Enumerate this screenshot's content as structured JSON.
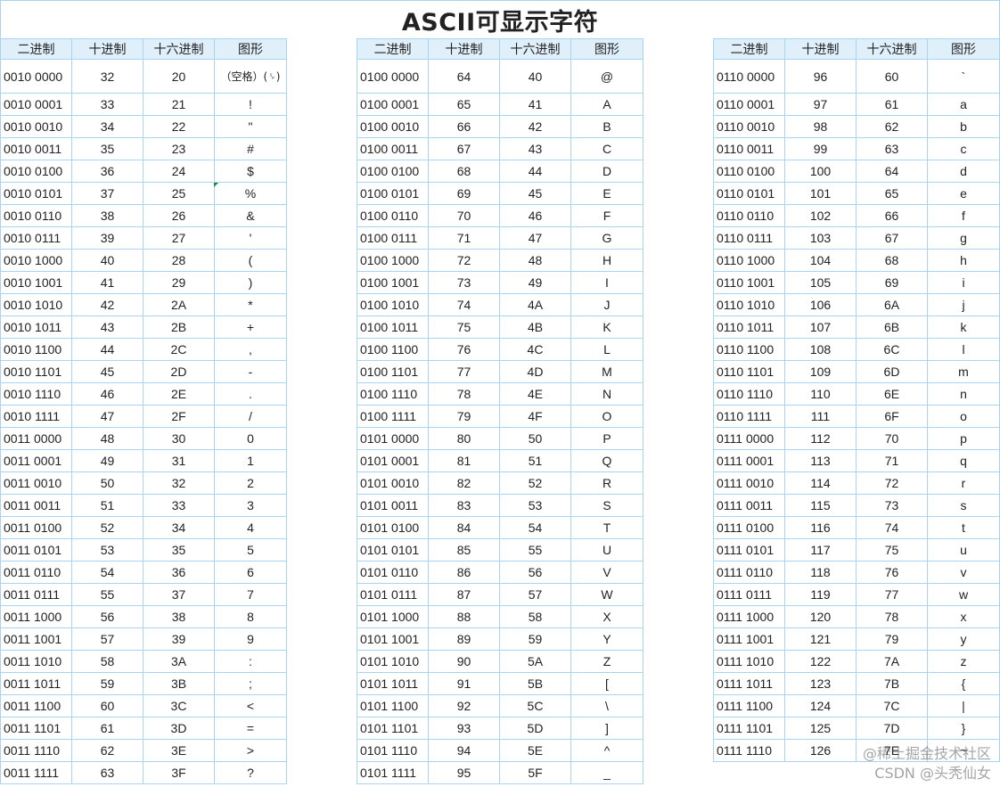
{
  "title": "ASCII可显示字符",
  "headers": [
    "二进制",
    "十进制",
    "十六进制",
    "图形"
  ],
  "tables": [
    [
      [
        "0010 0000",
        "32",
        "20",
        "（空格）(␠)"
      ],
      [
        "0010 0001",
        "33",
        "21",
        "!"
      ],
      [
        "0010 0010",
        "34",
        "22",
        "\""
      ],
      [
        "0010 0011",
        "35",
        "23",
        "#"
      ],
      [
        "0010 0100",
        "36",
        "24",
        "$"
      ],
      [
        "0010 0101",
        "37",
        "25",
        "%"
      ],
      [
        "0010 0110",
        "38",
        "26",
        "&"
      ],
      [
        "0010 0111",
        "39",
        "27",
        "'"
      ],
      [
        "0010 1000",
        "40",
        "28",
        "("
      ],
      [
        "0010 1001",
        "41",
        "29",
        ")"
      ],
      [
        "0010 1010",
        "42",
        "2A",
        "*"
      ],
      [
        "0010 1011",
        "43",
        "2B",
        "+"
      ],
      [
        "0010 1100",
        "44",
        "2C",
        ","
      ],
      [
        "0010 1101",
        "45",
        "2D",
        "-"
      ],
      [
        "0010 1110",
        "46",
        "2E",
        "."
      ],
      [
        "0010 1111",
        "47",
        "2F",
        "/"
      ],
      [
        "0011 0000",
        "48",
        "30",
        "0"
      ],
      [
        "0011 0001",
        "49",
        "31",
        "1"
      ],
      [
        "0011 0010",
        "50",
        "32",
        "2"
      ],
      [
        "0011 0011",
        "51",
        "33",
        "3"
      ],
      [
        "0011 0100",
        "52",
        "34",
        "4"
      ],
      [
        "0011 0101",
        "53",
        "35",
        "5"
      ],
      [
        "0011 0110",
        "54",
        "36",
        "6"
      ],
      [
        "0011 0111",
        "55",
        "37",
        "7"
      ],
      [
        "0011 1000",
        "56",
        "38",
        "8"
      ],
      [
        "0011 1001",
        "57",
        "39",
        "9"
      ],
      [
        "0011 1010",
        "58",
        "3A",
        ":"
      ],
      [
        "0011 1011",
        "59",
        "3B",
        ";"
      ],
      [
        "0011 1100",
        "60",
        "3C",
        "<"
      ],
      [
        "0011 1101",
        "61",
        "3D",
        "="
      ],
      [
        "0011 1110",
        "62",
        "3E",
        ">"
      ],
      [
        "0011 1111",
        "63",
        "3F",
        "?"
      ]
    ],
    [
      [
        "0100 0000",
        "64",
        "40",
        "@"
      ],
      [
        "0100 0001",
        "65",
        "41",
        "A"
      ],
      [
        "0100 0010",
        "66",
        "42",
        "B"
      ],
      [
        "0100 0011",
        "67",
        "43",
        "C"
      ],
      [
        "0100 0100",
        "68",
        "44",
        "D"
      ],
      [
        "0100 0101",
        "69",
        "45",
        "E"
      ],
      [
        "0100 0110",
        "70",
        "46",
        "F"
      ],
      [
        "0100 0111",
        "71",
        "47",
        "G"
      ],
      [
        "0100 1000",
        "72",
        "48",
        "H"
      ],
      [
        "0100 1001",
        "73",
        "49",
        "I"
      ],
      [
        "0100 1010",
        "74",
        "4A",
        "J"
      ],
      [
        "0100 1011",
        "75",
        "4B",
        "K"
      ],
      [
        "0100 1100",
        "76",
        "4C",
        "L"
      ],
      [
        "0100 1101",
        "77",
        "4D",
        "M"
      ],
      [
        "0100 1110",
        "78",
        "4E",
        "N"
      ],
      [
        "0100 1111",
        "79",
        "4F",
        "O"
      ],
      [
        "0101 0000",
        "80",
        "50",
        "P"
      ],
      [
        "0101 0001",
        "81",
        "51",
        "Q"
      ],
      [
        "0101 0010",
        "82",
        "52",
        "R"
      ],
      [
        "0101 0011",
        "83",
        "53",
        "S"
      ],
      [
        "0101 0100",
        "84",
        "54",
        "T"
      ],
      [
        "0101 0101",
        "85",
        "55",
        "U"
      ],
      [
        "0101 0110",
        "86",
        "56",
        "V"
      ],
      [
        "0101 0111",
        "87",
        "57",
        "W"
      ],
      [
        "0101 1000",
        "88",
        "58",
        "X"
      ],
      [
        "0101 1001",
        "89",
        "59",
        "Y"
      ],
      [
        "0101 1010",
        "90",
        "5A",
        "Z"
      ],
      [
        "0101 1011",
        "91",
        "5B",
        "["
      ],
      [
        "0101 1100",
        "92",
        "5C",
        "\\"
      ],
      [
        "0101 1101",
        "93",
        "5D",
        "]"
      ],
      [
        "0101 1110",
        "94",
        "5E",
        "^"
      ],
      [
        "0101 1111",
        "95",
        "5F",
        "_"
      ]
    ],
    [
      [
        "0110 0000",
        "96",
        "60",
        "`"
      ],
      [
        "0110 0001",
        "97",
        "61",
        "a"
      ],
      [
        "0110 0010",
        "98",
        "62",
        "b"
      ],
      [
        "0110 0011",
        "99",
        "63",
        "c"
      ],
      [
        "0110 0100",
        "100",
        "64",
        "d"
      ],
      [
        "0110 0101",
        "101",
        "65",
        "e"
      ],
      [
        "0110 0110",
        "102",
        "66",
        "f"
      ],
      [
        "0110 0111",
        "103",
        "67",
        "g"
      ],
      [
        "0110 1000",
        "104",
        "68",
        "h"
      ],
      [
        "0110 1001",
        "105",
        "69",
        "i"
      ],
      [
        "0110 1010",
        "106",
        "6A",
        "j"
      ],
      [
        "0110 1011",
        "107",
        "6B",
        "k"
      ],
      [
        "0110 1100",
        "108",
        "6C",
        "l"
      ],
      [
        "0110 1101",
        "109",
        "6D",
        "m"
      ],
      [
        "0110 1110",
        "110",
        "6E",
        "n"
      ],
      [
        "0110 1111",
        "111",
        "6F",
        "o"
      ],
      [
        "0111 0000",
        "112",
        "70",
        "p"
      ],
      [
        "0111 0001",
        "113",
        "71",
        "q"
      ],
      [
        "0111 0010",
        "114",
        "72",
        "r"
      ],
      [
        "0111 0011",
        "115",
        "73",
        "s"
      ],
      [
        "0111 0100",
        "116",
        "74",
        "t"
      ],
      [
        "0111 0101",
        "117",
        "75",
        "u"
      ],
      [
        "0111 0110",
        "118",
        "76",
        "v"
      ],
      [
        "0111 0111",
        "119",
        "77",
        "w"
      ],
      [
        "0111 1000",
        "120",
        "78",
        "x"
      ],
      [
        "0111 1001",
        "121",
        "79",
        "y"
      ],
      [
        "0111 1010",
        "122",
        "7A",
        "z"
      ],
      [
        "0111 1011",
        "123",
        "7B",
        "{"
      ],
      [
        "0111 1100",
        "124",
        "7C",
        "|"
      ],
      [
        "0111 1101",
        "125",
        "7D",
        "}"
      ],
      [
        "0111 1110",
        "126",
        "7E",
        "~"
      ]
    ]
  ],
  "watermark": {
    "line1": "@稀土掘金技术社区",
    "line2": "CSDN @头秃仙女"
  },
  "colors": {
    "border": "#a9d3ee",
    "header_bg": "#dff0fb"
  }
}
